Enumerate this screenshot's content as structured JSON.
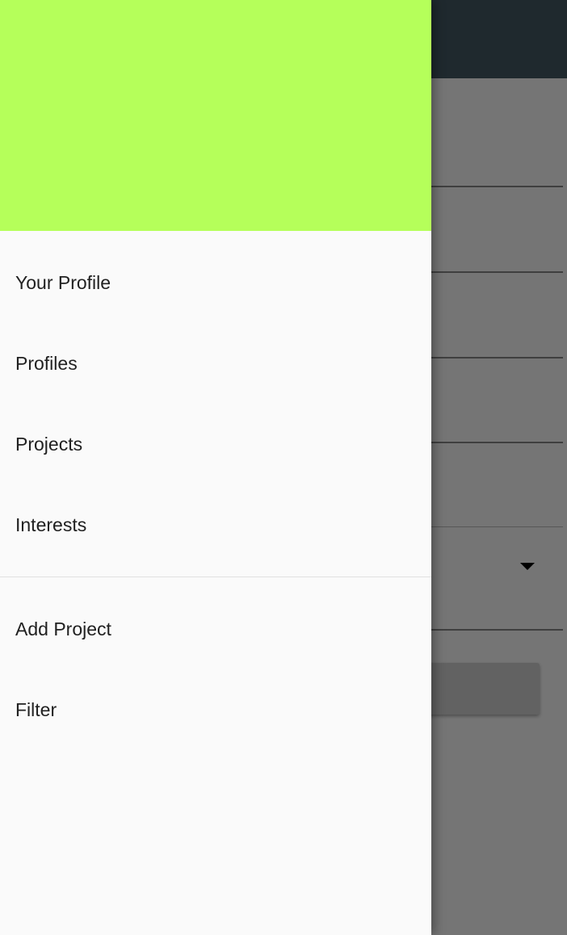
{
  "colors": {
    "app_bar": "#455a64",
    "drawer_header": "#b5ff5a",
    "drawer_background": "#fafafa",
    "scrim": "rgba(0,0,0,0.54)"
  },
  "drawer": {
    "primary_items": [
      {
        "label": "Your Profile"
      },
      {
        "label": "Profiles"
      },
      {
        "label": "Projects"
      },
      {
        "label": "Interests"
      }
    ],
    "secondary_items": [
      {
        "label": "Add Project"
      },
      {
        "label": "Filter"
      }
    ]
  },
  "background": {
    "dropdown_icon": "arrow-drop-down-icon"
  }
}
